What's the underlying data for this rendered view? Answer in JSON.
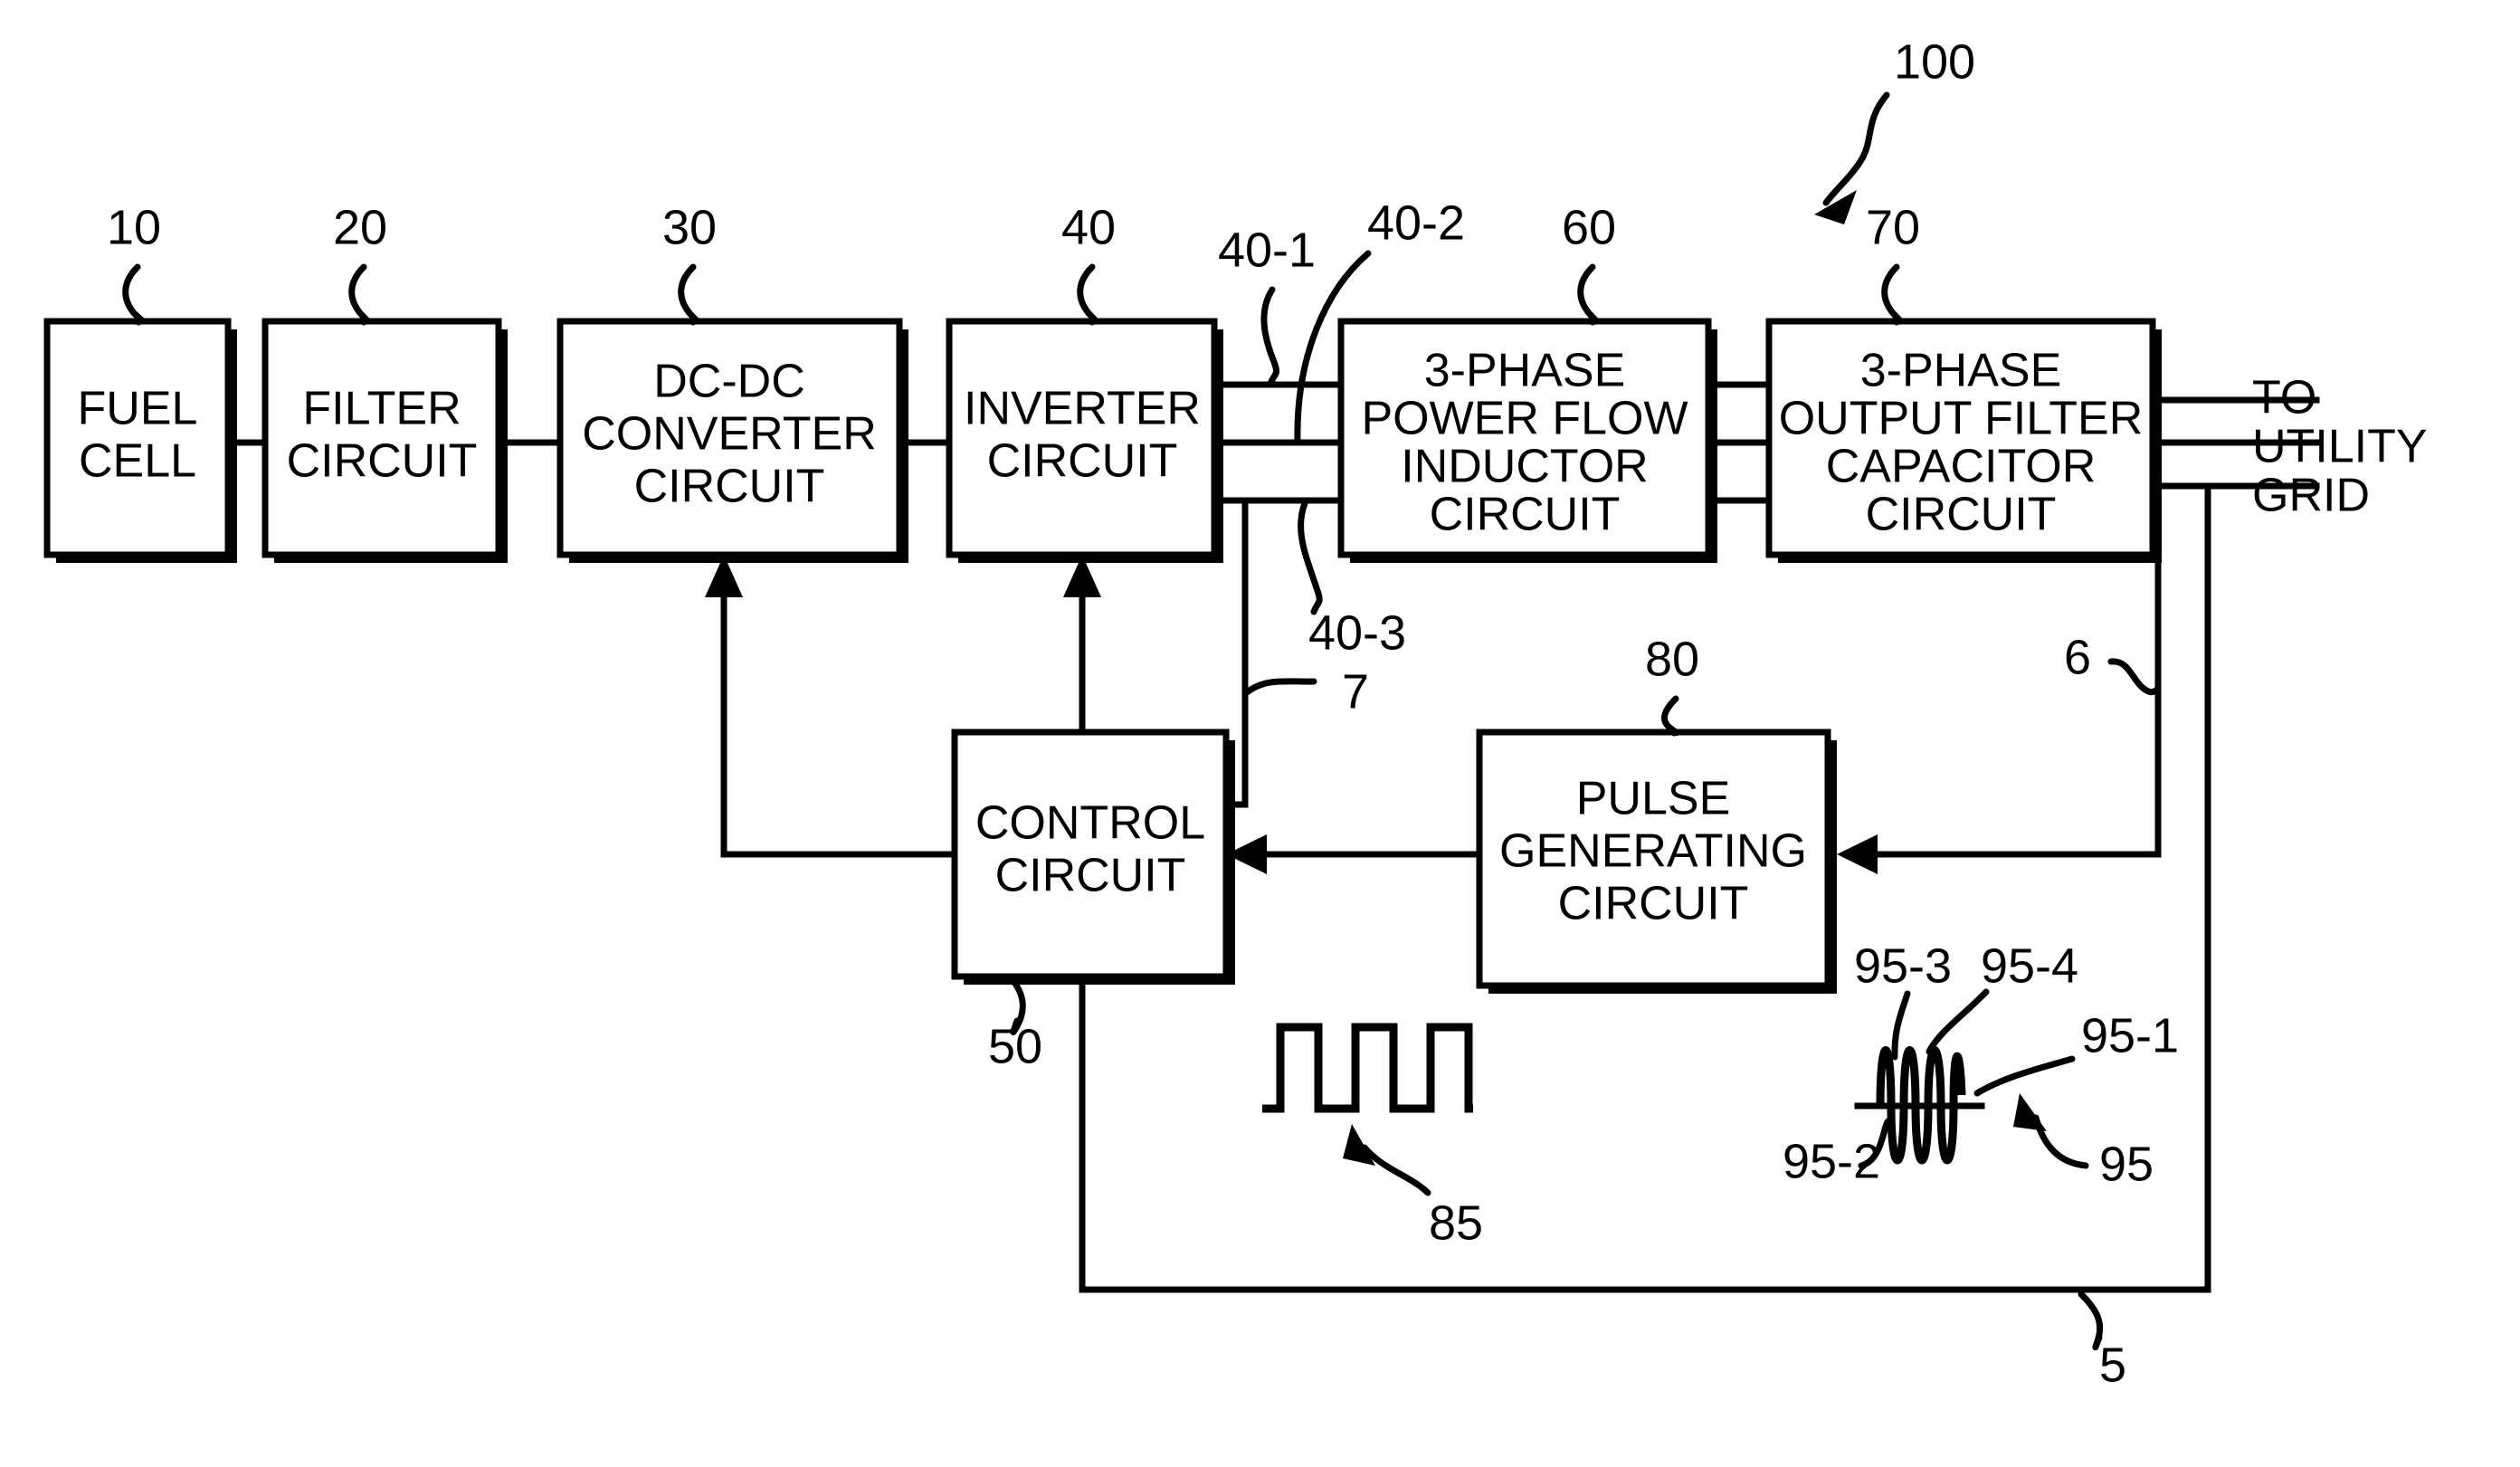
{
  "figure": {
    "overall_ref": "100",
    "blocks": [
      {
        "id": "fuel-cell",
        "ref": "10",
        "lines": [
          "FUEL",
          "CELL"
        ]
      },
      {
        "id": "filter-circuit",
        "ref": "20",
        "lines": [
          "FILTER",
          "CIRCUIT"
        ]
      },
      {
        "id": "dc-dc-converter",
        "ref": "30",
        "lines": [
          "DC-DC",
          "CONVERTER",
          "CIRCUIT"
        ]
      },
      {
        "id": "inverter",
        "ref": "40",
        "lines": [
          "INVERTER",
          "CIRCUIT"
        ]
      },
      {
        "id": "power-flow-inductor",
        "ref": "60",
        "lines": [
          "3-PHASE",
          "POWER FLOW",
          "INDUCTOR",
          "CIRCUIT"
        ]
      },
      {
        "id": "output-filter-capacitor",
        "ref": "70",
        "lines": [
          "3-PHASE",
          "OUTPUT FILTER",
          "CAPACITOR",
          "CIRCUIT"
        ]
      },
      {
        "id": "control-circuit",
        "ref": "50",
        "lines": [
          "CONTROL",
          "CIRCUIT"
        ]
      },
      {
        "id": "pulse-generating",
        "ref": "80",
        "lines": [
          "PULSE",
          "GENERATING",
          "CIRCUIT"
        ]
      }
    ],
    "phase_refs": [
      "40-1",
      "40-2",
      "40-3"
    ],
    "signal_refs": {
      "control_feedback": "7",
      "grid_sense": "6",
      "bottom_feedback": "5"
    },
    "destination_label": {
      "lines": [
        "TO",
        "UTILITY",
        "GRID"
      ]
    },
    "waveforms": [
      {
        "id": "pulse-waveform",
        "ref": "85",
        "type": "square-pulse-train",
        "pulse_count": 3
      },
      {
        "id": "sine-waveform",
        "ref": "95",
        "type": "sine-wave",
        "cycle_count": 3,
        "part_refs": [
          "95-1",
          "95-2",
          "95-3",
          "95-4"
        ]
      }
    ]
  },
  "colors": {
    "ink": "#000000",
    "paper": "#ffffff"
  }
}
